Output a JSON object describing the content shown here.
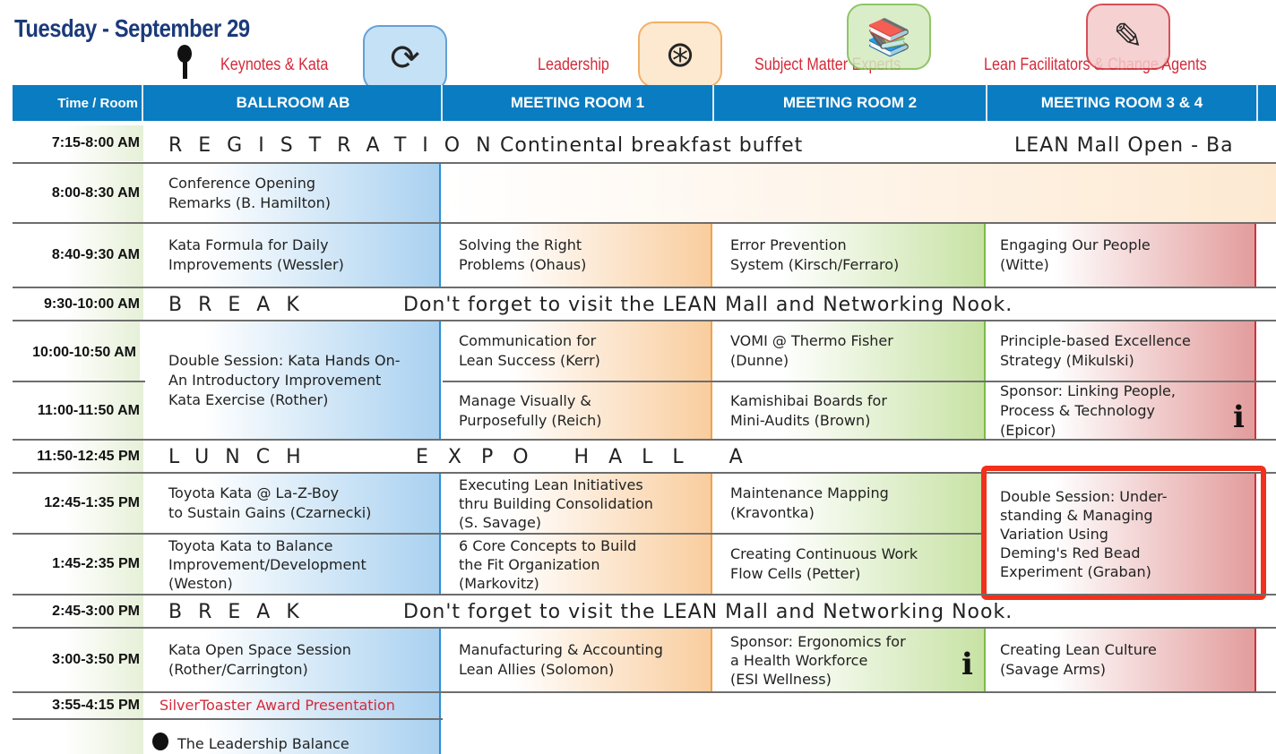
{
  "header": {
    "title": "Tuesday - September 29",
    "tracks": [
      {
        "label": "Keynotes & Kata",
        "icon": "key-icon"
      },
      {
        "label": "Leadership",
        "icon": "steering-wheel-icon"
      },
      {
        "label": "Subject Matter Experts",
        "icon": "books-icon"
      },
      {
        "label": "Lean Facilitators & Change Agents",
        "icon": "pencil-icon"
      }
    ],
    "columns": [
      "Time / Room",
      "BALLROOM AB",
      "MEETING ROOM 1",
      "MEETING ROOM 2",
      "MEETING ROOM 3 & 4"
    ]
  },
  "colors": {
    "header_bar": "#0a7cc1",
    "title": "#1b3a7a",
    "track_label": "#d42a3a",
    "highlight": "#f2301c"
  },
  "times": [
    "7:15-8:00 AM",
    "8:00-8:30 AM",
    "8:40-9:30 AM",
    "9:30-10:00 AM",
    "10:00-10:50 AM",
    "11:00-11:50 AM",
    "11:50-12:45 PM",
    "12:45-1:35 PM",
    "1:45-2:35 PM",
    "2:45-3:00 PM",
    "3:00-3:50 PM",
    "3:55-4:15 PM"
  ],
  "registration": {
    "label": "REGISTRATION",
    "breakfast": "Continental breakfast buffet",
    "mall": "LEAN Mall Open - Ba"
  },
  "break": {
    "label": "BREAK",
    "note": "Don't forget to visit the LEAN Mall and Networking Nook."
  },
  "lunch": {
    "label": "LUNCH",
    "location": "EXPO HALL A"
  },
  "sessions": {
    "opening": "Conference Opening\nRemarks (B. Hamilton)",
    "s840": [
      "Kata Formula for Daily\nImprovements (Wessler)",
      "Solving the Right\nProblems (Ohaus)",
      "Error Prevention\nSystem (Kirsch/Ferraro)",
      "Engaging Our People\n(Witte)"
    ],
    "s1000": [
      "Double Session: Kata Hands On-\nAn Introductory Improvement\nKata Exercise (Rother)",
      "Communication for\nLean Success (Kerr)",
      "VOMI @ Thermo Fisher\n(Dunne)",
      "Principle-based Excellence\nStrategy (Mikulski)"
    ],
    "s1100": [
      "Manage Visually &\nPurposefully (Reich)",
      "Kamishibai Boards for\nMini-Audits (Brown)",
      "Sponsor: Linking People,\nProcess & Technology\n(Epicor)"
    ],
    "s1245": [
      "Toyota Kata @ La-Z-Boy\nto Sustain Gains (Czarnecki)",
      "Executing Lean Initiatives\nthru Building Consolidation\n(S. Savage)",
      "Maintenance Mapping\n(Kravontka)",
      "Double Session: Under-\nstanding & Managing\nVariation Using\nDeming's Red Bead\nExperiment (Graban)"
    ],
    "s145": [
      "Toyota Kata to Balance\nImprovement/Development\n(Weston)",
      "6 Core Concepts to Build\nthe Fit Organization\n(Markovitz)",
      "Creating Continuous Work\nFlow Cells (Petter)"
    ],
    "s300": [
      "Kata Open Space Session\n(Rother/Carrington)",
      "Manufacturing & Accounting\nLean Allies (Solomon)",
      "Sponsor: Ergonomics for\na Health Workforce\n(ESI Wellness)",
      "Creating Lean Culture\n(Savage Arms)"
    ],
    "award": "SilverToaster Award Presentation",
    "last": "The Leadership Balance"
  },
  "info_glyph": "i"
}
